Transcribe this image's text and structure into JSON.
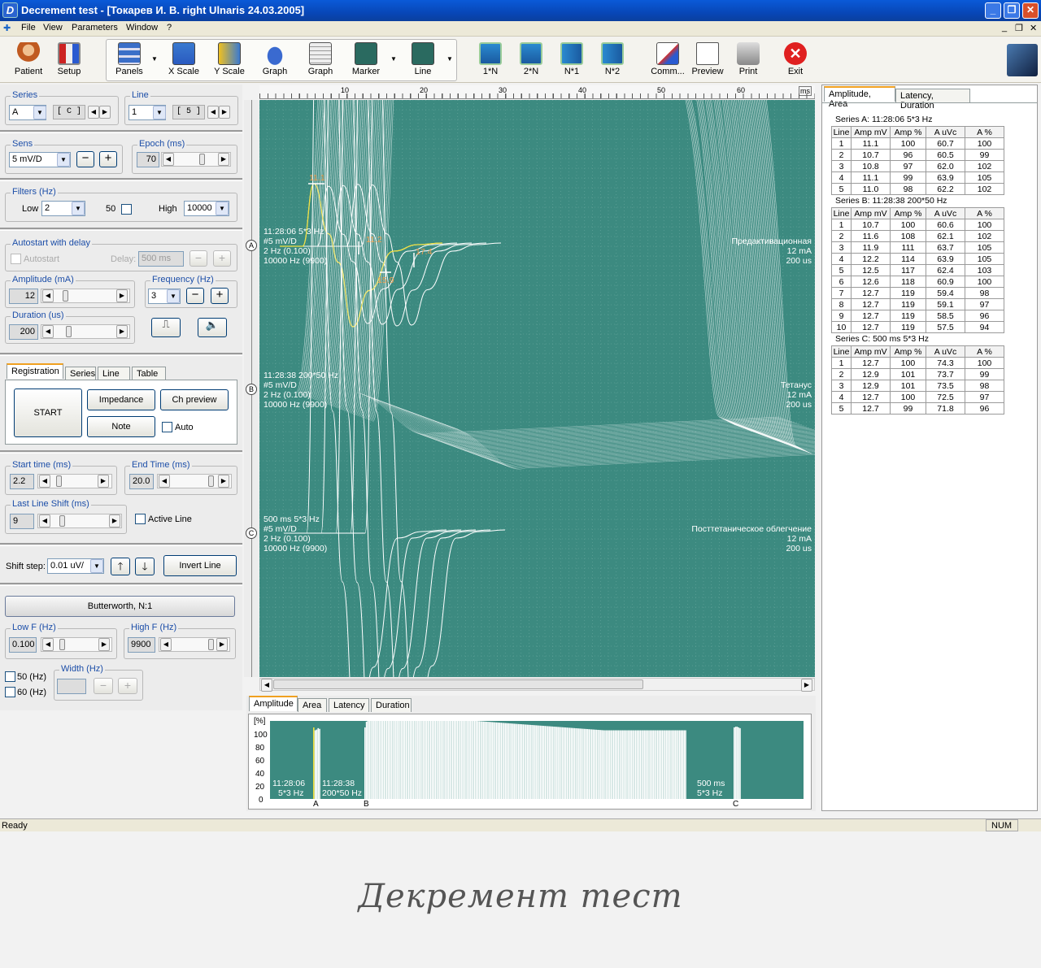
{
  "window": {
    "title": "Decrement test - [Токарев И. В. right Ulnaris 24.03.2005]",
    "logo": "D",
    "min": "_",
    "restore": "❐",
    "close": "✕"
  },
  "menu": {
    "items": [
      "File",
      "View",
      "Parameters",
      "Window",
      "?"
    ]
  },
  "toolbar": {
    "buttons": [
      {
        "label": "Patient",
        "icon": "patient-icon"
      },
      {
        "label": "Setup",
        "icon": "setup-icon"
      },
      {
        "label": "Panels",
        "icon": "panels-icon"
      },
      {
        "label": "X Scale",
        "icon": "x-scale-icon"
      },
      {
        "label": "Y Scale",
        "icon": "y-scale-icon"
      },
      {
        "label": "Graph",
        "icon": "graph-icon"
      },
      {
        "label": "Graph",
        "icon": "graph-grid-icon"
      },
      {
        "label": "Marker",
        "icon": "marker-icon"
      },
      {
        "label": "Line",
        "icon": "line-icon"
      },
      {
        "label": "1*N",
        "icon": "1n-icon"
      },
      {
        "label": "2*N",
        "icon": "2n-icon"
      },
      {
        "label": "N*1",
        "icon": "n1-icon"
      },
      {
        "label": "N*2",
        "icon": "n2-icon"
      },
      {
        "label": "Comm...",
        "icon": "comment-icon"
      },
      {
        "label": "Preview",
        "icon": "preview-icon"
      },
      {
        "label": "Print",
        "icon": "print-icon"
      },
      {
        "label": "Exit",
        "icon": "exit-icon"
      }
    ]
  },
  "left": {
    "series": {
      "label": "Series",
      "value": "A",
      "code": "[ C ]"
    },
    "line": {
      "label": "Line",
      "value": "1",
      "code": "[ 5 ]"
    },
    "sens": {
      "label": "Sens",
      "value": "5 mV/D"
    },
    "epoch": {
      "label": "Epoch (ms)",
      "value": "70"
    },
    "filters": {
      "label": "Filters (Hz)",
      "low_label": "Low",
      "low": "2",
      "notch": "50",
      "high_label": "High",
      "high": "10000"
    },
    "autostart": {
      "label": "Autostart with delay",
      "check": "Autostart",
      "delay_label": "Delay:",
      "delay": "500 ms"
    },
    "amplitude": {
      "label": "Amplitude (mA)",
      "value": "12"
    },
    "frequency": {
      "label": "Frequency (Hz)",
      "value": "3"
    },
    "duration": {
      "label": "Duration (us)",
      "value": "200"
    },
    "tabs": [
      "Registration",
      "Series",
      "Line",
      "Table"
    ],
    "start": "START",
    "impedance": "Impedance",
    "chpreview": "Ch preview",
    "note": "Note",
    "auto": "Auto",
    "start_time": {
      "label": "Start time (ms)",
      "value": "2.2"
    },
    "end_time": {
      "label": "End Time (ms)",
      "value": "20.0"
    },
    "last_shift": {
      "label": "Last Line Shift (ms)",
      "value": "9"
    },
    "active_line": "Active Line",
    "shift_step": {
      "label": "Shift step:",
      "value": "0.01 uV/"
    },
    "invert": "Invert Line",
    "butterworth": "Butterworth, N:1",
    "lowf": {
      "label": "Low F (Hz)",
      "value": "0.100"
    },
    "highf": {
      "label": "High F (Hz)",
      "value": "9900"
    },
    "hz50": "50 (Hz)",
    "hz60": "60 (Hz)",
    "width": {
      "label": "Width (Hz)"
    }
  },
  "ruler": {
    "ticks": [
      "10",
      "20",
      "30",
      "40",
      "50",
      "60"
    ],
    "unit": "ms"
  },
  "scope": {
    "markers": [
      "A",
      "B",
      "C"
    ],
    "series": [
      {
        "lines": [
          "11:28:06 5*3 Hz",
          "#5 mV/D",
          "2 Hz (0.100)",
          "10000 Hz (9900)"
        ],
        "right": [
          "Предактивационная",
          "12 mA",
          "200 us"
        ],
        "labels": [
          "11.1",
          "11.2",
          "15.9",
          "17.4"
        ]
      },
      {
        "lines": [
          "11:28:38 200*50 Hz",
          "#5 mV/D",
          "2 Hz (0.100)",
          "10000 Hz (9900)"
        ],
        "right": [
          "Тетанус",
          "12 mA",
          "200 us"
        ]
      },
      {
        "lines": [
          "500 ms 5*3 Hz",
          "#5 mV/D",
          "2 Hz (0.100)",
          "10000 Hz (9900)"
        ],
        "right": [
          "Посттетаническое облегчение",
          "12 mA",
          "200 us"
        ]
      }
    ]
  },
  "right": {
    "tabs": [
      "Amplitude, Area",
      "Latency, Duration"
    ],
    "headers": [
      "Line",
      "Amp mV",
      "Amp %",
      "A uVc",
      "A %"
    ],
    "tables": [
      {
        "title": "Series A: 11:28:06 5*3 Hz",
        "rows": [
          [
            "1",
            "11.1",
            "100",
            "60.7",
            "100"
          ],
          [
            "2",
            "10.7",
            "96",
            "60.5",
            "99"
          ],
          [
            "3",
            "10.8",
            "97",
            "62.0",
            "102"
          ],
          [
            "4",
            "11.1",
            "99",
            "63.9",
            "105"
          ],
          [
            "5",
            "11.0",
            "98",
            "62.2",
            "102"
          ]
        ]
      },
      {
        "title": "Series B: 11:28:38 200*50 Hz",
        "rows": [
          [
            "1",
            "10.7",
            "100",
            "60.6",
            "100"
          ],
          [
            "2",
            "11.6",
            "108",
            "62.1",
            "102"
          ],
          [
            "3",
            "11.9",
            "111",
            "63.7",
            "105"
          ],
          [
            "4",
            "12.2",
            "114",
            "63.9",
            "105"
          ],
          [
            "5",
            "12.5",
            "117",
            "62.4",
            "103"
          ],
          [
            "6",
            "12.6",
            "118",
            "60.9",
            "100"
          ],
          [
            "7",
            "12.7",
            "119",
            "59.4",
            "98"
          ],
          [
            "8",
            "12.7",
            "119",
            "59.1",
            "97"
          ],
          [
            "9",
            "12.7",
            "119",
            "58.5",
            "96"
          ],
          [
            "10",
            "12.7",
            "119",
            "57.5",
            "94"
          ]
        ]
      },
      {
        "title": "Series C: 500 ms 5*3 Hz",
        "rows": [
          [
            "1",
            "12.7",
            "100",
            "74.3",
            "100"
          ],
          [
            "2",
            "12.9",
            "101",
            "73.7",
            "99"
          ],
          [
            "3",
            "12.9",
            "101",
            "73.5",
            "98"
          ],
          [
            "4",
            "12.7",
            "100",
            "72.5",
            "97"
          ],
          [
            "5",
            "12.7",
            "99",
            "71.8",
            "96"
          ]
        ]
      }
    ]
  },
  "bottom": {
    "tabs": [
      "Amplitude",
      "Area",
      "Latency",
      "Duration"
    ],
    "unit": "[%]",
    "yticks": [
      "100",
      "80",
      "60",
      "40",
      "20",
      "0"
    ],
    "annot": [
      {
        "t1": "11:28:06",
        "t2": "5*3 Hz",
        "letter": "A"
      },
      {
        "t1": "11:28:38",
        "t2": "200*50 Hz",
        "letter": "B"
      },
      {
        "t1": "500 ms",
        "t2": "5*3 Hz",
        "letter": "C"
      }
    ]
  },
  "chart_data": {
    "type": "bar",
    "ylabel": "[%]",
    "ylim": [
      0,
      100
    ],
    "series": [
      {
        "name": "A",
        "values": [
          100,
          96,
          97,
          99,
          98
        ]
      },
      {
        "name": "B",
        "values": [
          100,
          108,
          111,
          114,
          117,
          118,
          119,
          119,
          119,
          119
        ]
      },
      {
        "name": "C",
        "values": [
          100,
          101,
          101,
          100,
          99
        ]
      }
    ]
  },
  "status": {
    "text": "Ready",
    "num": "NUM"
  },
  "caption": "Декремент тест",
  "colors": {
    "scope": "#3c8a80",
    "trace": "#ffffff",
    "marker": "#f0e040",
    "label": "#f0a050",
    "titlebar": "#0a5ad8"
  }
}
